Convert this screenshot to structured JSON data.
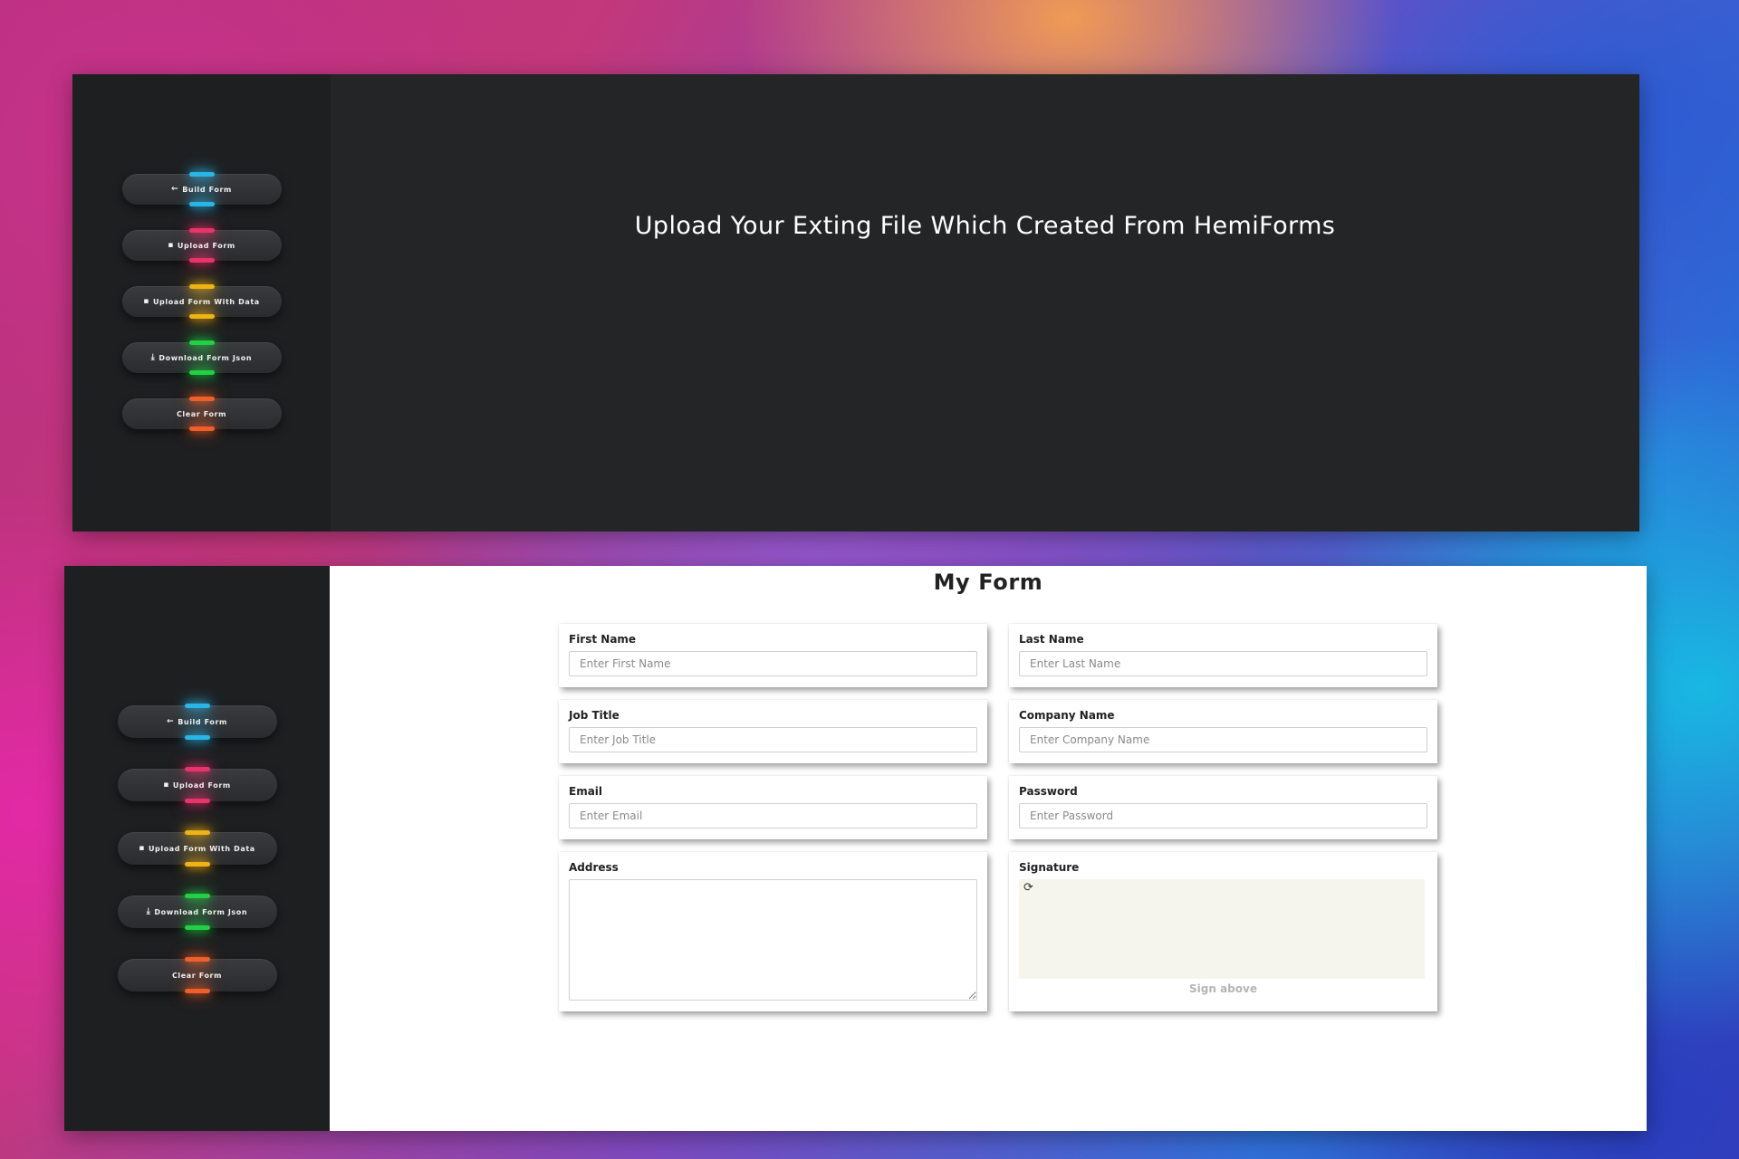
{
  "sidebar": {
    "buttons": [
      {
        "icon": "←",
        "icon_name": "arrow-left-icon",
        "label": "Build Form",
        "accent": "#2bb5e6"
      },
      {
        "icon": "▪",
        "icon_name": "file-icon",
        "label": "Upload Form",
        "accent": "#e8336b"
      },
      {
        "icon": "▪",
        "icon_name": "file-icon",
        "label": "Upload Form With Data",
        "accent": "#f0b316"
      },
      {
        "icon": "⤓",
        "icon_name": "download-icon",
        "label": "Download Form Json",
        "accent": "#22d045"
      },
      {
        "icon": "",
        "icon_name": "",
        "label": "Clear Form",
        "accent": "#ef5f2a"
      }
    ]
  },
  "upload_panel": {
    "heading": "Upload Your Exting File Which Created From HemiForms"
  },
  "form": {
    "title": "My Form",
    "fields": {
      "first_name": {
        "label": "First Name",
        "placeholder": "Enter First Name"
      },
      "last_name": {
        "label": "Last Name",
        "placeholder": "Enter Last Name"
      },
      "job_title": {
        "label": "Job Title",
        "placeholder": "Enter Job Title"
      },
      "company_name": {
        "label": "Company Name",
        "placeholder": "Enter Company Name"
      },
      "email": {
        "label": "Email",
        "placeholder": "Enter Email"
      },
      "password": {
        "label": "Password",
        "placeholder": "Enter Password"
      },
      "address": {
        "label": "Address",
        "placeholder": ""
      },
      "signature": {
        "label": "Signature",
        "refresh_icon": "⟳",
        "hint": "Sign above"
      }
    }
  }
}
